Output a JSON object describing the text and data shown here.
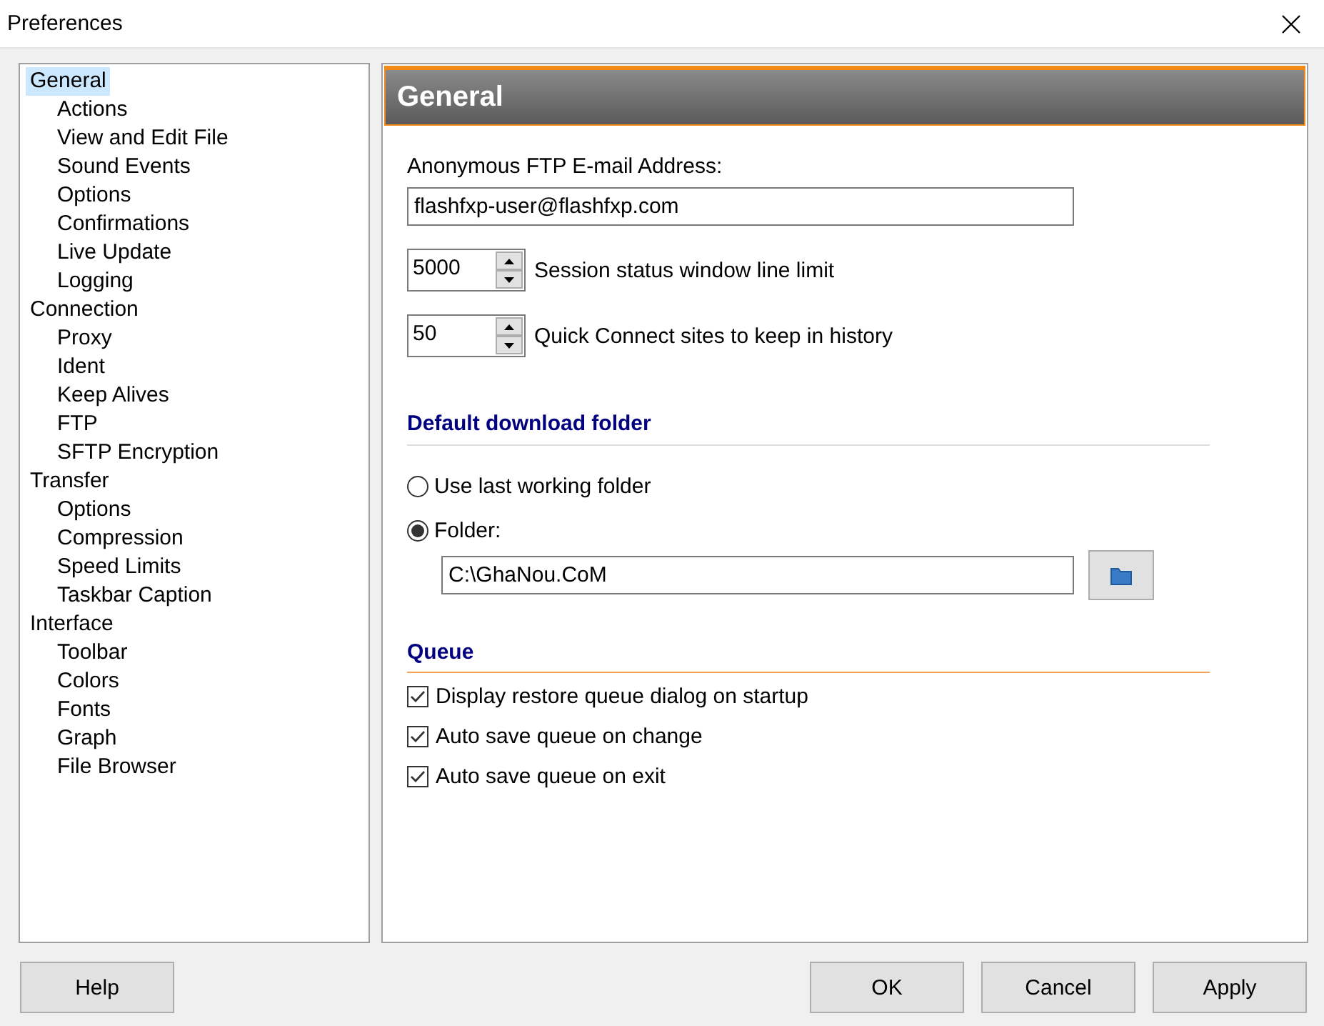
{
  "window": {
    "title": "Preferences"
  },
  "tree": [
    {
      "label": "General",
      "selected": true,
      "children": [
        {
          "label": "Actions",
          "selected": false
        },
        {
          "label": "View and Edit File",
          "selected": false
        },
        {
          "label": "Sound Events",
          "selected": false
        },
        {
          "label": "Options",
          "selected": false
        },
        {
          "label": "Confirmations",
          "selected": false
        },
        {
          "label": "Live Update",
          "selected": false
        },
        {
          "label": "Logging",
          "selected": false
        }
      ]
    },
    {
      "label": "Connection",
      "selected": false,
      "children": [
        {
          "label": "Proxy",
          "selected": false
        },
        {
          "label": "Ident",
          "selected": false
        },
        {
          "label": "Keep Alives",
          "selected": false
        },
        {
          "label": "FTP",
          "selected": false
        },
        {
          "label": "SFTP Encryption",
          "selected": false
        }
      ]
    },
    {
      "label": "Transfer",
      "selected": false,
      "children": [
        {
          "label": "Options",
          "selected": false
        },
        {
          "label": "Compression",
          "selected": false
        },
        {
          "label": "Speed Limits",
          "selected": false
        },
        {
          "label": "Taskbar Caption",
          "selected": false
        }
      ]
    },
    {
      "label": "Interface",
      "selected": false,
      "children": [
        {
          "label": "Toolbar",
          "selected": false
        },
        {
          "label": "Colors",
          "selected": false
        },
        {
          "label": "Fonts",
          "selected": false
        },
        {
          "label": "Graph",
          "selected": false
        },
        {
          "label": "File Browser",
          "selected": false
        }
      ]
    }
  ],
  "panel": {
    "title": "General",
    "email": {
      "label": "Anonymous FTP E-mail Address:",
      "value": "flashfxp-user@flashfxp.com"
    },
    "spinners": [
      {
        "value": "5000",
        "label": "Session status window line limit"
      },
      {
        "value": "50",
        "label": "Quick Connect sites to keep in history"
      }
    ],
    "download": {
      "heading": "Default download folder",
      "options": [
        {
          "label": "Use last working folder",
          "selected": false
        },
        {
          "label": "Folder:",
          "selected": true
        }
      ],
      "folder_value": "C:\\GhaNou.CoM"
    },
    "queue": {
      "heading": "Queue",
      "options": [
        {
          "label": "Display restore queue dialog on startup",
          "checked": true
        },
        {
          "label": "Auto save queue on change",
          "checked": true
        },
        {
          "label": "Auto save queue on exit",
          "checked": true
        }
      ]
    }
  },
  "buttons": [
    {
      "label": "Help"
    },
    {
      "label": "OK"
    },
    {
      "label": "Cancel"
    },
    {
      "label": "Apply"
    }
  ]
}
